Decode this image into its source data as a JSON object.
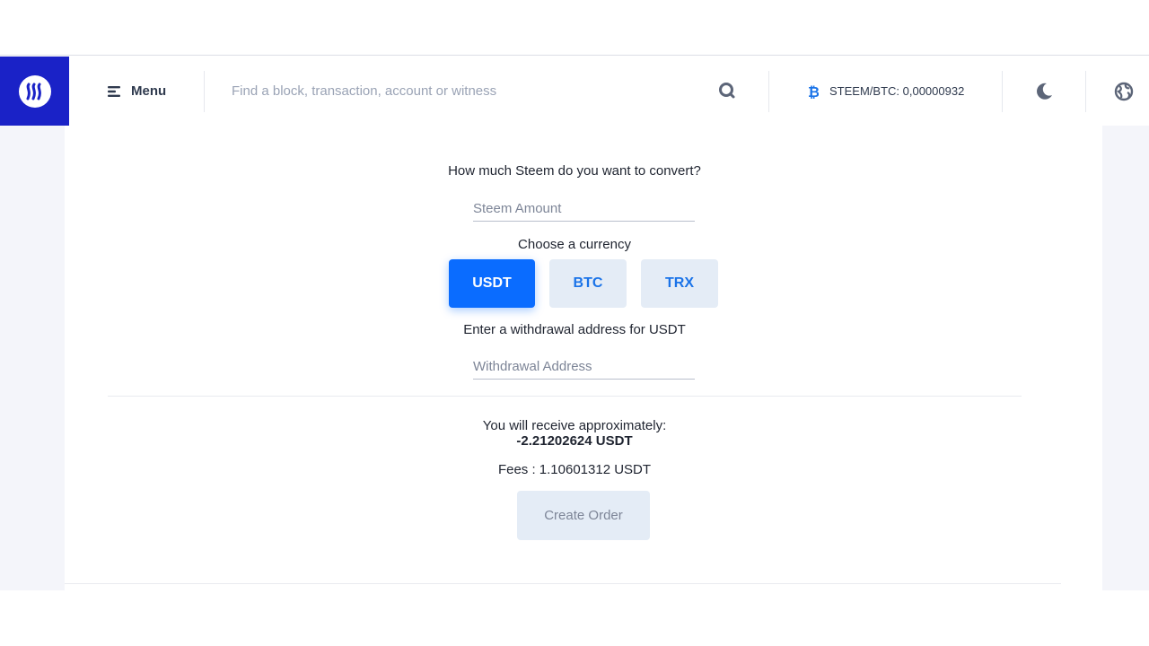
{
  "header": {
    "menu_label": "Menu",
    "search_placeholder": "Find a block, transaction, account or witness",
    "price_label": "STEEM/BTC: 0,00000932"
  },
  "form": {
    "amount_question": "How much Steem do you want to convert?",
    "amount_placeholder": "Steem Amount",
    "currency_question": "Choose a currency",
    "currencies": [
      {
        "label": "USDT",
        "selected": true
      },
      {
        "label": "BTC",
        "selected": false
      },
      {
        "label": "TRX",
        "selected": false
      }
    ],
    "address_question": "Enter a withdrawal address for USDT",
    "address_placeholder": "Withdrawal Address",
    "receive_label": "You will receive approximately:",
    "receive_value": "-2.21202624 USDT",
    "fees_text": "Fees : 1.10601312 USDT",
    "create_order_label": "Create Order"
  },
  "colors": {
    "brand": "#1a22c7",
    "accent": "#0a6cff",
    "bitcoin_icon": "#1a73e8"
  }
}
